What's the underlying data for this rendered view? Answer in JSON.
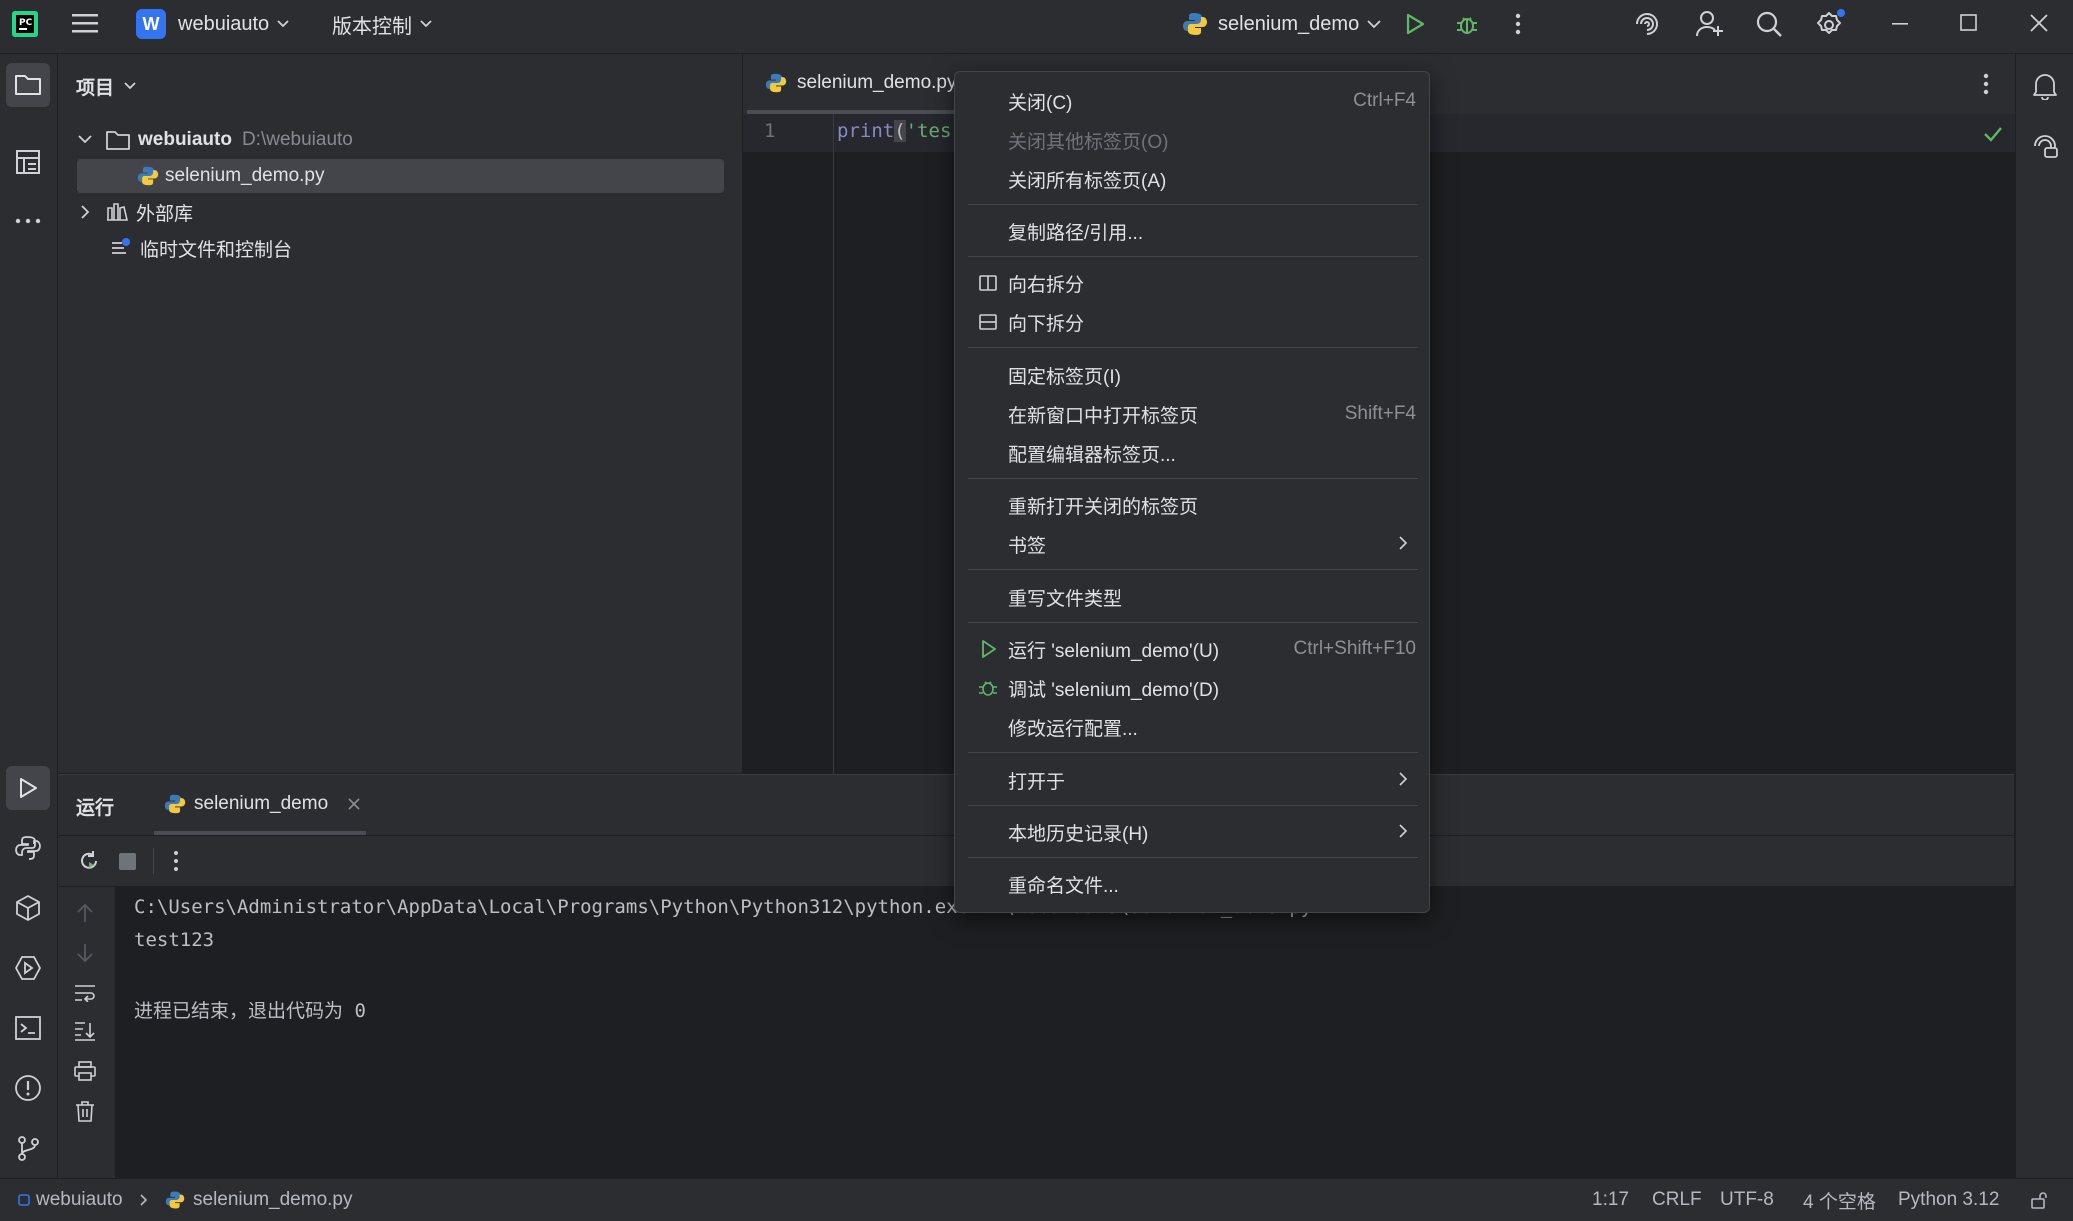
{
  "titlebar": {
    "project_letter": "W",
    "project_name": "webuiauto",
    "vcs_label": "版本控制",
    "run_config": "selenium_demo"
  },
  "project_panel": {
    "title": "项目",
    "root_name": "webuiauto",
    "root_path": "D:\\webuiauto",
    "file_name": "selenium_demo.py",
    "external_libs": "外部库",
    "scratches": "临时文件和控制台"
  },
  "editor": {
    "tab_label": "selenium_demo.py",
    "line_number": "1",
    "code_fn": "print",
    "code_paren": "(",
    "code_str": "'tes"
  },
  "context_menu": {
    "items": [
      {
        "label": "关闭(C)",
        "shortcut": "Ctrl+F4"
      },
      {
        "label": "关闭其他标签页(O)",
        "shortcut": ""
      },
      {
        "label": "关闭所有标签页(A)",
        "shortcut": ""
      },
      {
        "label": "复制路径/引用...",
        "shortcut": ""
      },
      {
        "label": "向右拆分",
        "shortcut": ""
      },
      {
        "label": "向下拆分",
        "shortcut": ""
      },
      {
        "label": "固定标签页(I)",
        "shortcut": ""
      },
      {
        "label": "在新窗口中打开标签页",
        "shortcut": "Shift+F4"
      },
      {
        "label": "配置编辑器标签页...",
        "shortcut": ""
      },
      {
        "label": "重新打开关闭的标签页",
        "shortcut": ""
      },
      {
        "label": "书签",
        "shortcut": ""
      },
      {
        "label": "重写文件类型",
        "shortcut": ""
      },
      {
        "label": "运行 'selenium_demo'(U)",
        "shortcut": "Ctrl+Shift+F10"
      },
      {
        "label": "调试 'selenium_demo'(D)",
        "shortcut": ""
      },
      {
        "label": "修改运行配置...",
        "shortcut": ""
      },
      {
        "label": "打开于",
        "shortcut": ""
      },
      {
        "label": "本地历史记录(H)",
        "shortcut": ""
      },
      {
        "label": "重命名文件...",
        "shortcut": ""
      }
    ]
  },
  "run_panel": {
    "title": "运行",
    "tab_label": "selenium_demo",
    "console_cmd": "C:\\Users\\Administrator\\AppData\\Local\\Programs\\Python\\Python312\\python.exe D:\\webuiauto\\selenium_demo.py",
    "console_output": "test123",
    "console_exit": "进程已结束，退出代码为 0"
  },
  "statusbar": {
    "crumb_project": "webuiauto",
    "crumb_file": "selenium_demo.py",
    "position": "1:17",
    "line_sep": "CRLF",
    "encoding": "UTF-8",
    "indent": "4 个空格",
    "interpreter": "Python 3.12"
  },
  "colors": {
    "accent": "#3574f0",
    "run_green": "#5fb865",
    "background": "#1e1f22",
    "panel": "#2b2d30"
  }
}
